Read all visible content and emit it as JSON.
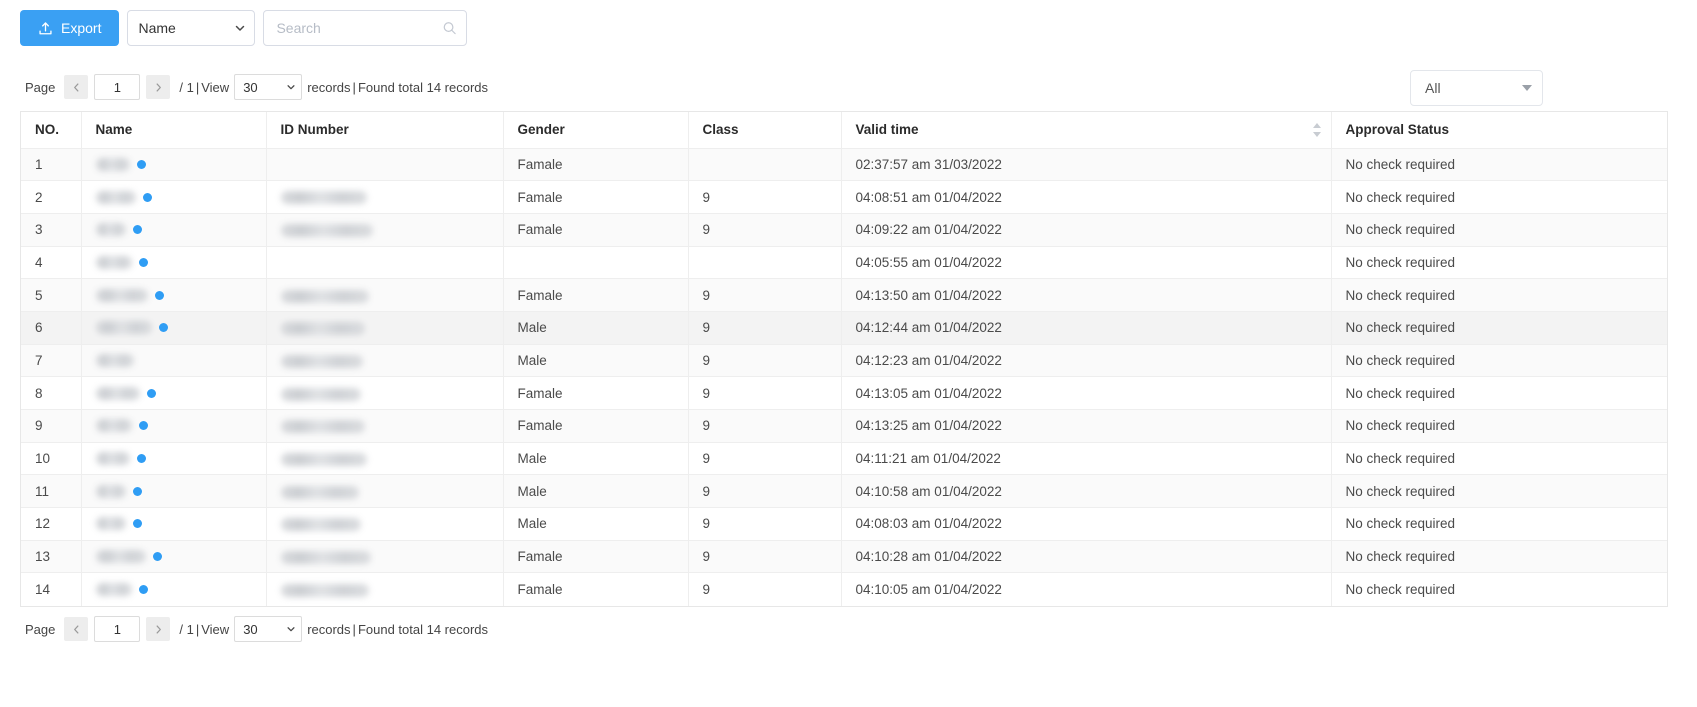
{
  "toolbar": {
    "export_label": "Export",
    "export_icon": "upload-icon",
    "export_color": "#3aa0f3",
    "field_select_value": "Name",
    "field_select_options": [
      "Name"
    ],
    "search_placeholder": "Search",
    "search_value": "",
    "search_icon": "search-icon"
  },
  "pagination": {
    "page_label": "Page",
    "prev_icon": "chevron-left-icon",
    "next_icon": "chevron-right-icon",
    "current_page": "1",
    "total_pages_label": "/ 1",
    "separator": "|",
    "view_label": "View",
    "page_size": "30",
    "page_size_options": [
      "30"
    ],
    "records_label": "records",
    "found_label": "Found total 14 records"
  },
  "status_filter": {
    "value": "All",
    "options": [
      "All"
    ],
    "caret_icon": "caret-down-icon"
  },
  "table": {
    "columns": [
      {
        "key": "no",
        "label": "NO.",
        "sortable": false
      },
      {
        "key": "name",
        "label": "Name",
        "sortable": false
      },
      {
        "key": "id_number",
        "label": "ID Number",
        "sortable": false
      },
      {
        "key": "gender",
        "label": "Gender",
        "sortable": false
      },
      {
        "key": "class",
        "label": "Class",
        "sortable": false
      },
      {
        "key": "valid_time",
        "label": "Valid time",
        "sortable": true
      },
      {
        "key": "approval_status",
        "label": "Approval Status",
        "sortable": false
      }
    ],
    "rows": [
      {
        "no": "1",
        "name": "",
        "name_redacted": true,
        "name_redact_width": 34,
        "name_has_dot": true,
        "id_number": "",
        "id_redacted": false,
        "id_redact_width": 0,
        "gender": "Famale",
        "class": "",
        "valid_time": "02:37:57 am 31/03/2022",
        "approval_status": "No check required",
        "hovered": false
      },
      {
        "no": "2",
        "name": "",
        "name_redacted": true,
        "name_redact_width": 40,
        "name_has_dot": true,
        "id_number": "",
        "id_redacted": true,
        "id_redact_width": 86,
        "gender": "Famale",
        "class": "9",
        "valid_time": "04:08:51 am 01/04/2022",
        "approval_status": "No check required",
        "hovered": false
      },
      {
        "no": "3",
        "name": "",
        "name_redacted": true,
        "name_redact_width": 30,
        "name_has_dot": true,
        "id_number": "",
        "id_redacted": true,
        "id_redact_width": 92,
        "gender": "Famale",
        "class": "9",
        "valid_time": "04:09:22 am 01/04/2022",
        "approval_status": "No check required",
        "hovered": false
      },
      {
        "no": "4",
        "name": "",
        "name_redacted": true,
        "name_redact_width": 36,
        "name_has_dot": true,
        "id_number": "",
        "id_redacted": false,
        "id_redact_width": 0,
        "gender": "",
        "class": "",
        "valid_time": "04:05:55 am 01/04/2022",
        "approval_status": "No check required",
        "hovered": false
      },
      {
        "no": "5",
        "name": "",
        "name_redacted": true,
        "name_redact_width": 52,
        "name_has_dot": true,
        "id_number": "",
        "id_redacted": true,
        "id_redact_width": 88,
        "gender": "Famale",
        "class": "9",
        "valid_time": "04:13:50 am 01/04/2022",
        "approval_status": "No check required",
        "hovered": false
      },
      {
        "no": "6",
        "name": "",
        "name_redacted": true,
        "name_redact_width": 56,
        "name_has_dot": true,
        "id_number": "",
        "id_redacted": true,
        "id_redact_width": 84,
        "gender": "Male",
        "class": "9",
        "valid_time": "04:12:44 am 01/04/2022",
        "approval_status": "No check required",
        "hovered": true
      },
      {
        "no": "7",
        "name": "",
        "name_redacted": true,
        "name_redact_width": 38,
        "name_has_dot": false,
        "id_number": "",
        "id_redacted": true,
        "id_redact_width": 82,
        "gender": "Male",
        "class": "9",
        "valid_time": "04:12:23 am 01/04/2022",
        "approval_status": "No check required",
        "hovered": false
      },
      {
        "no": "8",
        "name": "",
        "name_redacted": true,
        "name_redact_width": 44,
        "name_has_dot": true,
        "id_number": "",
        "id_redacted": true,
        "id_redact_width": 80,
        "gender": "Famale",
        "class": "9",
        "valid_time": "04:13:05 am 01/04/2022",
        "approval_status": "No check required",
        "hovered": false
      },
      {
        "no": "9",
        "name": "",
        "name_redacted": true,
        "name_redact_width": 36,
        "name_has_dot": true,
        "id_number": "",
        "id_redacted": true,
        "id_redact_width": 84,
        "gender": "Famale",
        "class": "9",
        "valid_time": "04:13:25 am 01/04/2022",
        "approval_status": "No check required",
        "hovered": false
      },
      {
        "no": "10",
        "name": "",
        "name_redacted": true,
        "name_redact_width": 34,
        "name_has_dot": true,
        "id_number": "",
        "id_redacted": true,
        "id_redact_width": 86,
        "gender": "Male",
        "class": "9",
        "valid_time": "04:11:21 am 01/04/2022",
        "approval_status": "No check required",
        "hovered": false
      },
      {
        "no": "11",
        "name": "",
        "name_redacted": true,
        "name_redact_width": 30,
        "name_has_dot": true,
        "id_number": "",
        "id_redacted": true,
        "id_redact_width": 78,
        "gender": "Male",
        "class": "9",
        "valid_time": "04:10:58 am 01/04/2022",
        "approval_status": "No check required",
        "hovered": false
      },
      {
        "no": "12",
        "name": "",
        "name_redacted": true,
        "name_redact_width": 30,
        "name_has_dot": true,
        "id_number": "",
        "id_redacted": true,
        "id_redact_width": 80,
        "gender": "Male",
        "class": "9",
        "valid_time": "04:08:03 am 01/04/2022",
        "approval_status": "No check required",
        "hovered": false
      },
      {
        "no": "13",
        "name": "",
        "name_redacted": true,
        "name_redact_width": 50,
        "name_has_dot": true,
        "id_number": "",
        "id_redacted": true,
        "id_redact_width": 90,
        "gender": "Famale",
        "class": "9",
        "valid_time": "04:10:28 am 01/04/2022",
        "approval_status": "No check required",
        "hovered": false
      },
      {
        "no": "14",
        "name": "",
        "name_redacted": true,
        "name_redact_width": 36,
        "name_has_dot": true,
        "id_number": "",
        "id_redacted": true,
        "id_redact_width": 88,
        "gender": "Famale",
        "class": "9",
        "valid_time": "04:10:05 am 01/04/2022",
        "approval_status": "No check required",
        "hovered": false
      }
    ]
  }
}
